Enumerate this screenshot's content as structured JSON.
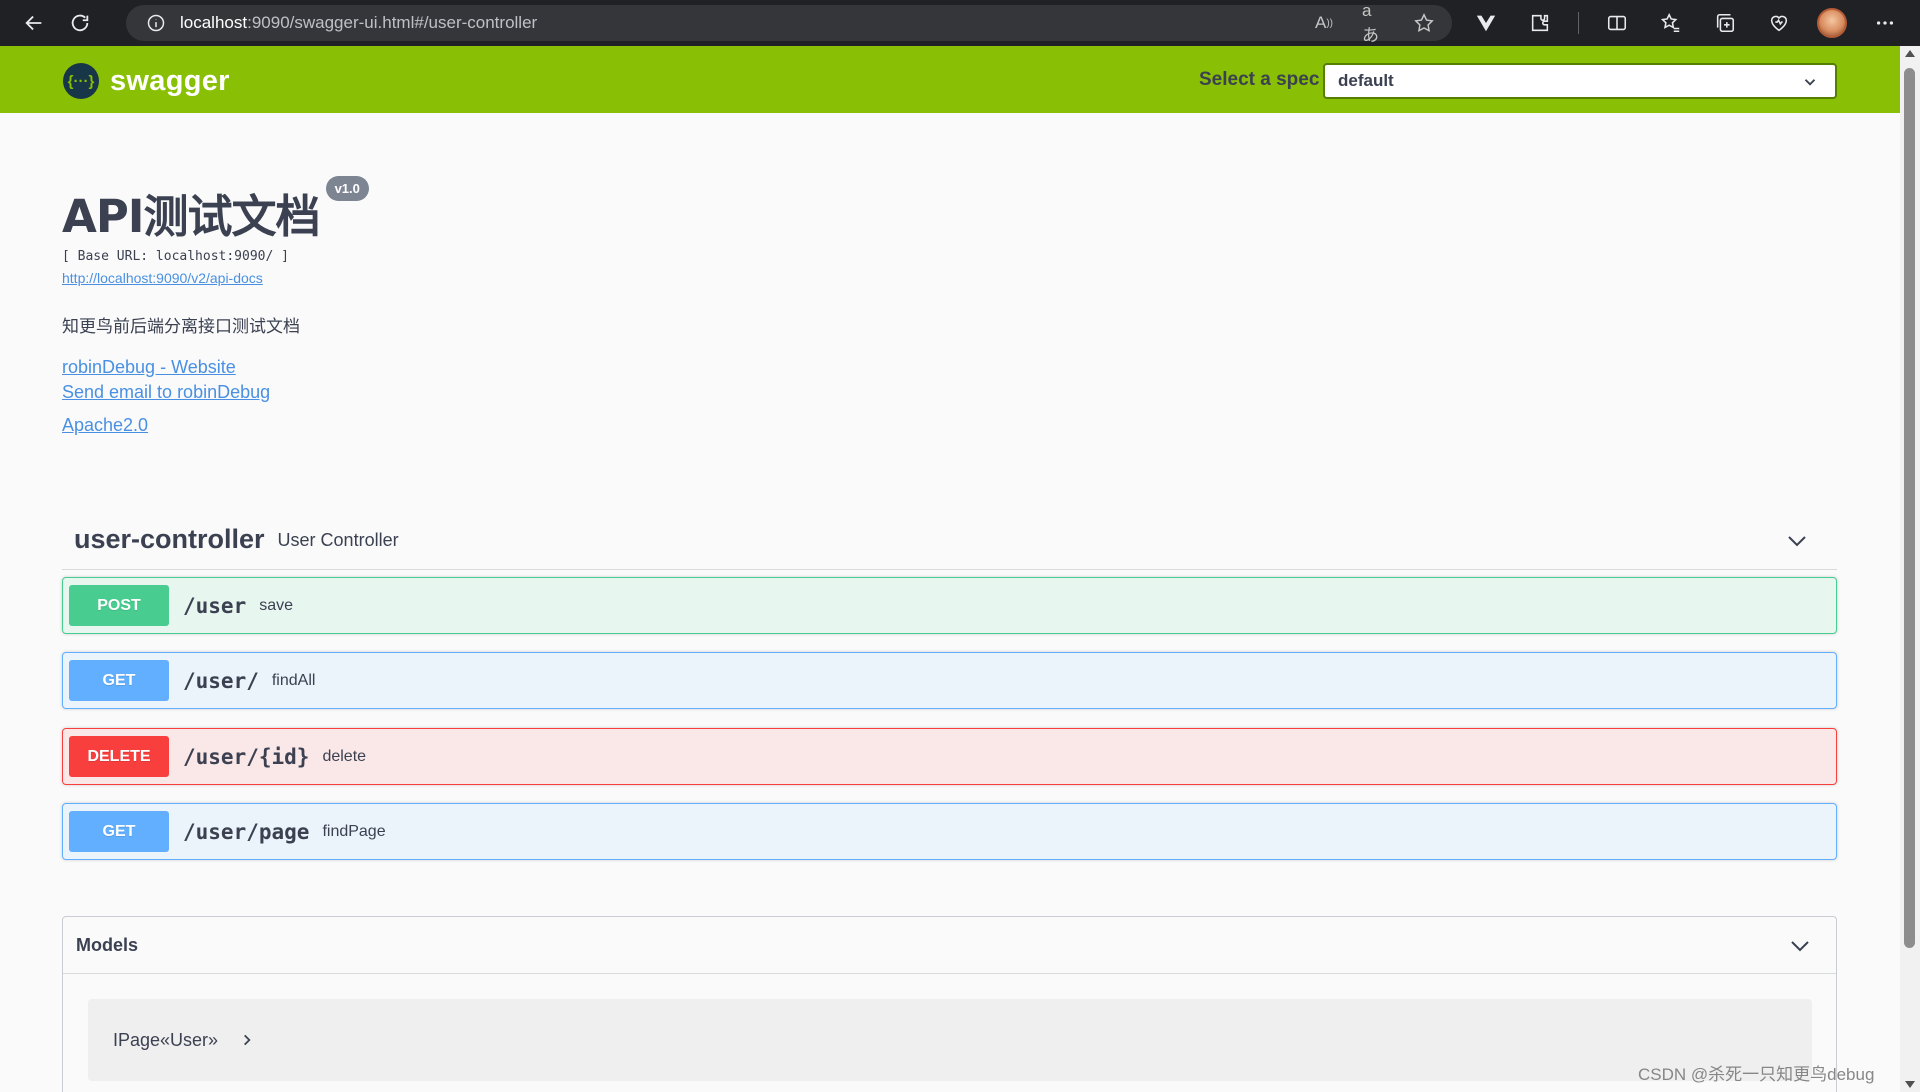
{
  "browser": {
    "url_host": "localhost",
    "url_rest": ":9090/swagger-ui.html#/user-controller"
  },
  "topbar": {
    "logo_symbol": "{···}",
    "logo_text": "swagger",
    "spec_label": "Select a spec",
    "spec_value": "default"
  },
  "info": {
    "title": "API测试文档",
    "version": "v1.0",
    "base_url": "[ Base URL: localhost:9090/ ]",
    "api_docs_link": "http://localhost:9090/v2/api-docs",
    "description": "知更鸟前后端分离接口测试文档",
    "website_link": "robinDebug - Website",
    "email_link": "Send email to robinDebug",
    "license_link": "Apache2.0"
  },
  "tag": {
    "name": "user-controller",
    "description": "User Controller"
  },
  "operations": [
    {
      "method": "POST",
      "path": "/user",
      "summary": "save"
    },
    {
      "method": "GET",
      "path": "/user/",
      "summary": "findAll"
    },
    {
      "method": "DELETE",
      "path": "/user/{id}",
      "summary": "delete"
    },
    {
      "method": "GET",
      "path": "/user/page",
      "summary": "findPage"
    }
  ],
  "models": {
    "title": "Models",
    "items": [
      "IPage«User»"
    ]
  },
  "watermark": "CSDN @杀死一只知更鸟debug",
  "colors": {
    "topbar": "#89bf04",
    "post": "#49cc90",
    "get": "#61affe",
    "delete": "#f93e3e",
    "link": "#4990e2",
    "text": "#3b4151"
  }
}
